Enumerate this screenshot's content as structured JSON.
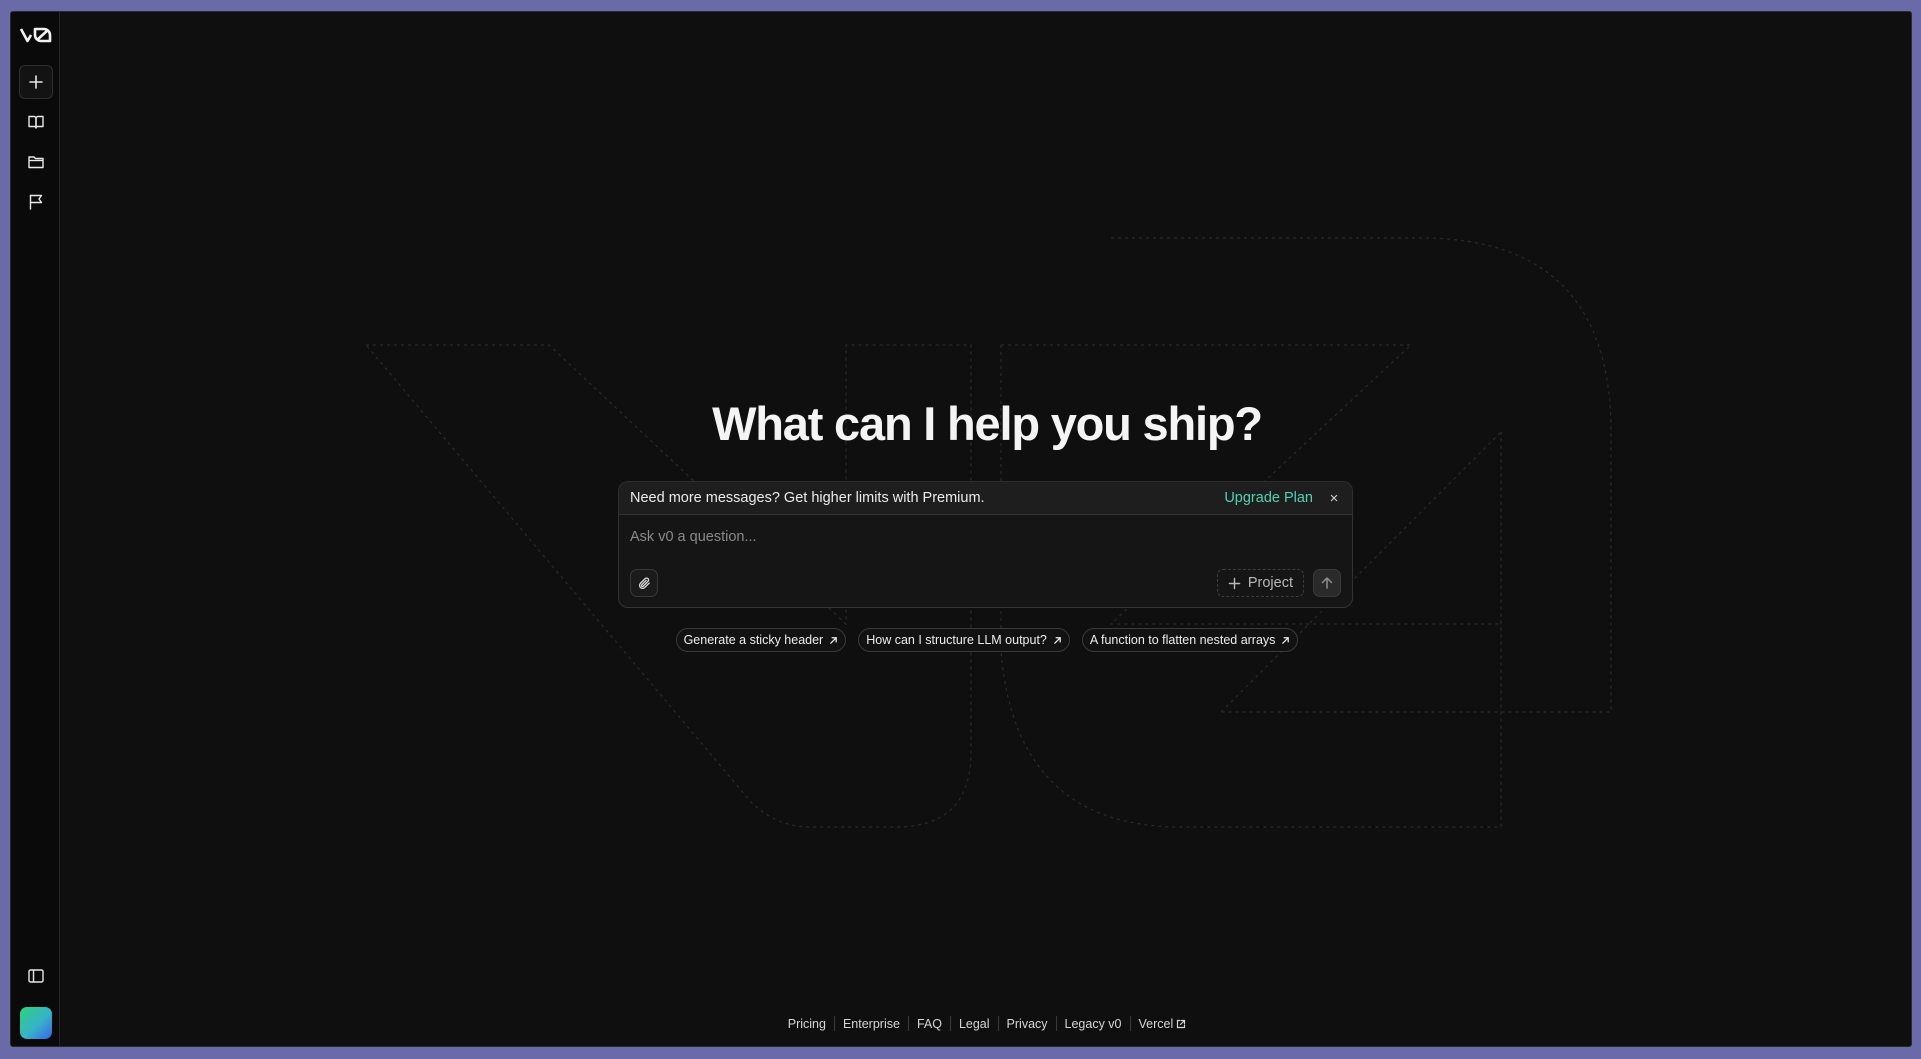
{
  "app": {
    "logo_text": "v0"
  },
  "sidebar": {
    "items": [
      {
        "name": "new-chat",
        "icon": "plus-icon"
      },
      {
        "name": "library",
        "icon": "book-icon"
      },
      {
        "name": "projects",
        "icon": "folder-icon"
      },
      {
        "name": "feedback",
        "icon": "flag-icon"
      }
    ],
    "bottom": [
      {
        "name": "toggle-sidebar",
        "icon": "sidebar-icon"
      },
      {
        "name": "user-avatar",
        "icon": "avatar"
      }
    ]
  },
  "main": {
    "headline": "What can I help you ship?",
    "promo": {
      "text": "Need more messages? Get higher limits with Premium.",
      "action": "Upgrade Plan",
      "close": "×"
    },
    "prompt": {
      "placeholder": "Ask v0 a question...",
      "value": "",
      "project_label": "Project"
    },
    "suggestions": [
      "Generate a sticky header",
      "How can I structure LLM output?",
      "A function to flatten nested arrays"
    ]
  },
  "footer": {
    "links": [
      "Pricing",
      "Enterprise",
      "FAQ",
      "Legal",
      "Privacy",
      "Legacy v0",
      "Vercel"
    ]
  },
  "colors": {
    "background": "#0f0f0f",
    "sidebar": "#0a0a0a",
    "accent": "#52d1b5",
    "text": "#f4f4f4"
  }
}
